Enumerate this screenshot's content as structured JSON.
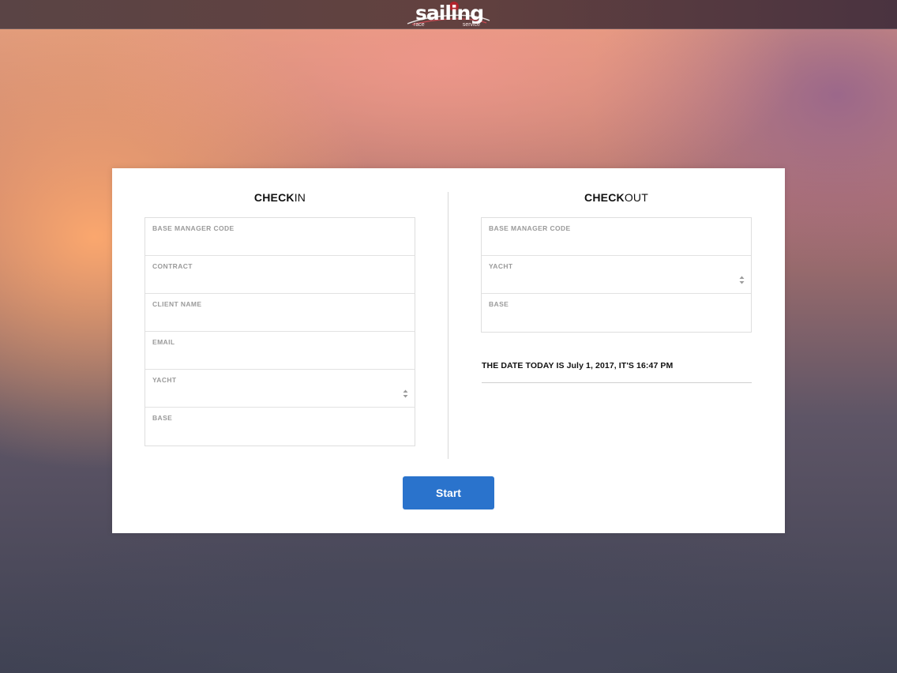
{
  "header": {
    "logo_word": "sailing",
    "logo_sub_left": "race",
    "logo_sub_right": "service"
  },
  "checkin": {
    "title_bold": "CHECK",
    "title_light": "IN",
    "fields": [
      {
        "label": "BASE MANAGER CODE",
        "value": ""
      },
      {
        "label": "CONTRACT",
        "value": ""
      },
      {
        "label": "CLIENT NAME",
        "value": ""
      },
      {
        "label": "EMAIL",
        "value": ""
      },
      {
        "label": "YACHT",
        "value": ""
      },
      {
        "label": "BASE",
        "value": ""
      }
    ]
  },
  "checkout": {
    "title_bold": "CHECK",
    "title_light": "OUT",
    "fields": [
      {
        "label": "BASE MANAGER CODE",
        "value": ""
      },
      {
        "label": "YACHT",
        "value": ""
      },
      {
        "label": "BASE",
        "value": ""
      }
    ],
    "date_text": "THE DATE TODAY IS July 1, 2017, IT'S 16:47 PM"
  },
  "actions": {
    "start_label": "Start",
    "start_color": "#2a73cc"
  }
}
